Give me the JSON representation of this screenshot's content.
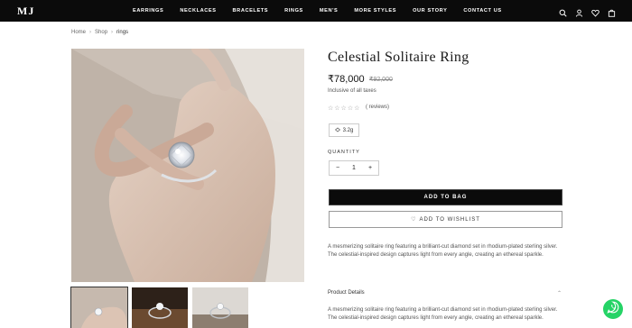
{
  "brand": {
    "logo": "MJ"
  },
  "nav": {
    "items": [
      {
        "label": "EARRINGS"
      },
      {
        "label": "NECKLACES"
      },
      {
        "label": "BRACELETS"
      },
      {
        "label": "RINGS"
      },
      {
        "label": "MEN'S"
      },
      {
        "label": "MORE STYLES"
      },
      {
        "label": "OUR STORY"
      },
      {
        "label": "CONTACT US"
      }
    ],
    "icons": [
      "search-icon",
      "user-icon",
      "heart-icon",
      "cart-icon"
    ]
  },
  "breadcrumb": {
    "home": "Home",
    "shop": "Shop",
    "current": "rings",
    "sep": "›"
  },
  "product": {
    "title": "Celestial Solitaire Ring",
    "price": "₹78,000",
    "old_price": "₹92,000",
    "taxes": "Inclusive of all taxes",
    "stars": "☆☆☆☆☆",
    "rating_stars": 0,
    "reviews": "( reviews)",
    "weight": "3.2g",
    "quantity_label": "QUANTITY",
    "quantity_minus": "−",
    "quantity_value": "1",
    "quantity_plus": "+",
    "add_to_bag": "ADD TO BAG",
    "add_to_wishlist": "ADD TO WISHLIST",
    "wishlist_heart": "♡",
    "description": "A mesmerizing solitaire ring featuring a brilliant-cut diamond set in rhodium-plated sterling silver. The celestial-inspired design captures light from every angle, creating an ethereal sparkle.",
    "details_heading": "Product Details",
    "details_chevron": "⌃",
    "details_text": "A mesmerizing solitaire ring featuring a brilliant-cut diamond set in rhodium-plated sterling silver. The celestial-inspired design captures light from every angle, creating an ethereal sparkle."
  },
  "colors": {
    "nav_bg": "#0b0b0b",
    "accent": "#0b0b0b",
    "whatsapp": "#25d366"
  }
}
